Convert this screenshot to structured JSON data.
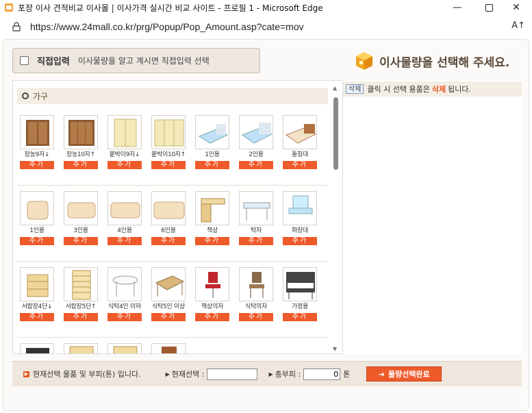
{
  "window": {
    "title": "포장 이사 견적비교 이사몰 | 이사가격 실시간 비교 사이트 - 프로필 1 - Microsoft Edge",
    "controls": [
      "minimize-icon",
      "maximize-icon",
      "close-icon"
    ]
  },
  "address": {
    "url": "https://www.24mall.co.kr/prg/Popup/Pop_Amount.asp?cate=mov",
    "read_aloud": "A↑"
  },
  "direct_input": {
    "label": "직접입력",
    "description": "이사물량을 알고 계시면 직접입력 선택"
  },
  "select_title": "이사물량을 선택해 주세요.",
  "category": "가구",
  "add_label": "추가",
  "rows": [
    [
      "장농9자↓",
      "장농10자↑",
      "붙박이9자↓",
      "붙박이10자↑",
      "1인용",
      "2인용",
      "돌침대"
    ],
    [
      "1인용",
      "3인용",
      "4인용",
      "6인용",
      "책상",
      "탁자",
      "화장대"
    ],
    [
      "서랍장4단↓",
      "서랍장5단↑",
      "식탁4인 이하",
      "식탁5인 이상",
      "책상의자",
      "식탁의자",
      "가정용"
    ]
  ],
  "selection_hint": {
    "delete_label": "삭제",
    "text_before": "클릭 시 선택 용품은",
    "highlight": "삭제",
    "text_after": "됩니다."
  },
  "bottom": {
    "info": "현재선택 물품 및 부피(톤) 입니다.",
    "current_label": "현재선택 :",
    "current_value": "",
    "total_label": "총부피 :",
    "total_value": "0",
    "unit": "톤",
    "done_label": "물량선택완료",
    "done_arrow": "➜"
  },
  "colors": {
    "accent": "#ef5a2a",
    "header_bg": "#f3ede3",
    "bottom_bg": "#efe7dd"
  }
}
